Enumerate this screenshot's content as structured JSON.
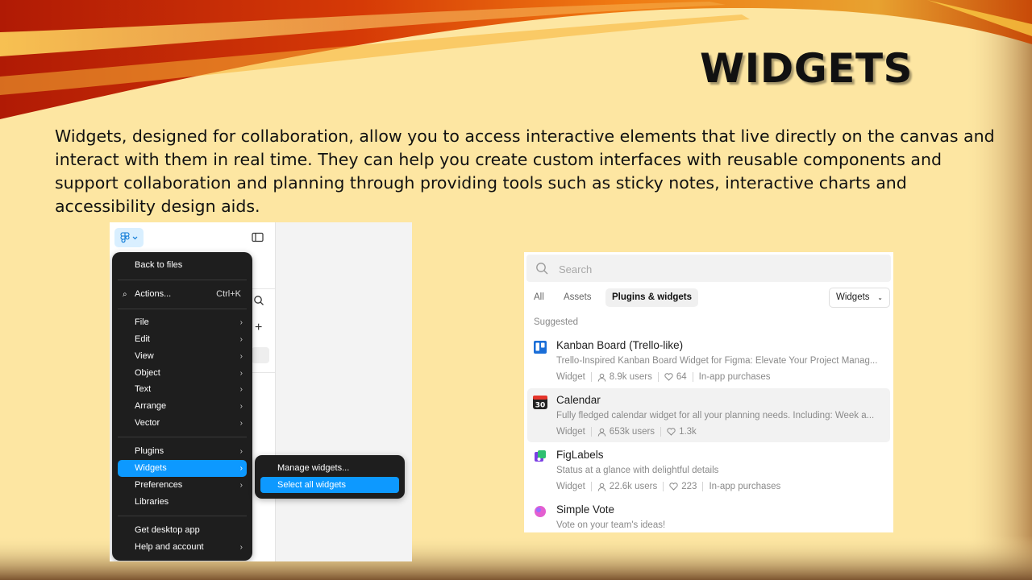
{
  "slide": {
    "title": "WIDGETS",
    "body": "Widgets, designed for collaboration, allow you to access interactive elements that live directly on the canvas and interact with them in real time. They can help you create custom interfaces with reusable components and support collaboration and planning through providing tools such as sticky notes, interactive charts and accessibility design aids."
  },
  "menu": {
    "back": "Back to files",
    "actions": {
      "label": "Actions...",
      "shortcut": "Ctrl+K"
    },
    "group1": [
      "File",
      "Edit",
      "View",
      "Object",
      "Text",
      "Arrange",
      "Vector"
    ],
    "group2": [
      "Plugins",
      "Widgets",
      "Preferences",
      "Libraries"
    ],
    "group3": [
      "Get desktop app",
      "Help and account"
    ],
    "active_item": "Widgets",
    "submenu": [
      "Manage widgets...",
      "Select all widgets"
    ],
    "submenu_active": "Select all widgets",
    "arrow": "›",
    "search_glyph": "⌕",
    "plus_glyph": "+"
  },
  "panel": {
    "search_placeholder": "Search",
    "tabs": [
      "All",
      "Assets",
      "Plugins & widgets"
    ],
    "selected_tab": "Plugins & widgets",
    "filter": "Widgets",
    "filter_chevron": "⌄",
    "section": "Suggested",
    "items": [
      {
        "name": "Kanban Board (Trello-like)",
        "desc": "Trello-Inspired Kanban Board Widget for Figma: Elevate Your Project Manag...",
        "type": "Widget",
        "users": "8.9k users",
        "likes": "64",
        "extra": "In-app purchases",
        "icon": "kanban-icon"
      },
      {
        "name": "Calendar",
        "desc": "Fully fledged calendar widget for all your planning needs. Including: Week a...",
        "type": "Widget",
        "users": "653k users",
        "likes": "1.3k",
        "extra": "",
        "icon": "calendar-icon",
        "icon_text": "30"
      },
      {
        "name": "FigLabels",
        "desc": "Status at a glance with delightful details",
        "type": "Widget",
        "users": "22.6k users",
        "likes": "223",
        "extra": "In-app purchases",
        "icon": "figlabels-icon"
      },
      {
        "name": "Simple Vote",
        "desc": "Vote on your team's ideas!",
        "icon": "vote-icon"
      }
    ]
  },
  "colors": {
    "accent": "#0d99ff",
    "slide_bg": "#fde6a2",
    "menu_bg": "#1e1e1e"
  }
}
